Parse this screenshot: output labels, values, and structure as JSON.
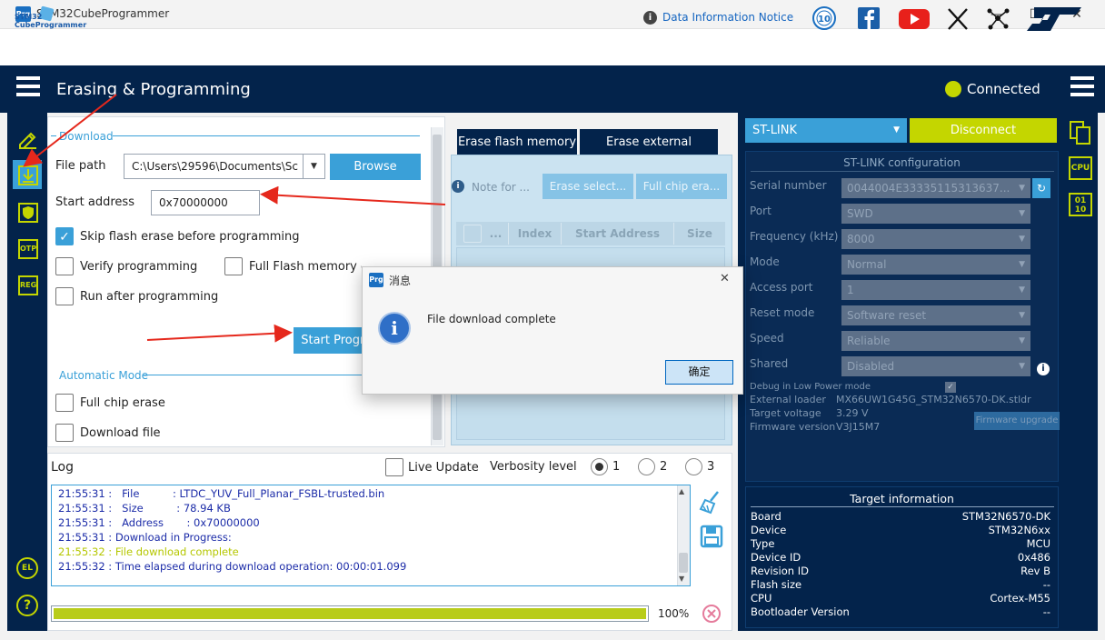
{
  "window": {
    "app_icon": "Prg",
    "title": "STM32CubeProgrammer",
    "minimize": "—",
    "maximize": "☐",
    "close": "✕"
  },
  "header": {
    "logo_line1": "STM32",
    "logo_line2": "CubeProgrammer",
    "notice_icon": "i",
    "notice_link": "Data Information Notice",
    "anniversary_badge": "10",
    "social_icons": [
      "anniversary-icon",
      "facebook-icon",
      "youtube-icon",
      "x-icon",
      "network-icon",
      "st-logo-icon"
    ]
  },
  "ribbon": {
    "page_title": "Erasing & Programming",
    "connection_status": "Connected",
    "status_color": "#c4d600"
  },
  "sidebar": {
    "items": [
      "edit-icon",
      "download-icon",
      "shield-icon",
      "otp-icon",
      "reg-icon"
    ],
    "otp_label": "OTP",
    "reg_label": "REG",
    "bottom_el_icon": "EL",
    "help_icon": "?"
  },
  "download": {
    "section_label": "Download",
    "file_path_label": "File path",
    "file_path_value": "C:\\Users\\29596\\Documents\\Sc",
    "browse_label": "Browse",
    "start_address_label": "Start address",
    "start_address_value": "0x70000000",
    "skip_flash_erase_label": "Skip flash erase before programming",
    "skip_flash_erase_checked": true,
    "verify_label": "Verify programming",
    "full_checksum_label": "Full Flash memory checksum",
    "run_after_label": "Run after programming",
    "start_button_label": "Start Programming"
  },
  "automatic_mode": {
    "section_label": "Automatic Mode",
    "full_chip_erase_label": "Full chip erase",
    "download_file_label": "Download file"
  },
  "erase": {
    "tab_flash": "Erase flash memory",
    "tab_external": "Erase external memory",
    "note_label": "Note for ...",
    "erase_selected_label": "Erase select...",
    "full_chip_label": "Full chip era...",
    "columns": [
      "...",
      "Index",
      "Start Address",
      "Size"
    ]
  },
  "log": {
    "title": "Log",
    "live_update_label": "Live Update",
    "verbosity_label": "Verbosity level",
    "levels": [
      "1",
      "2",
      "3"
    ],
    "selected_level": "1",
    "lines": [
      "21:55:31 :   File          : LTDC_YUV_Full_Planar_FSBL-trusted.bin",
      "21:55:31 :   Size          : 78.94 KB",
      "21:55:31 :   Address       : 0x70000000",
      "21:55:31 : Download in Progress:",
      "21:55:32 : File download complete",
      "21:55:32 : Time elapsed during download operation: 00:00:01.099"
    ],
    "progress_fraction": 1.0,
    "progress_text": "100%"
  },
  "stlink": {
    "dropdown_label": "ST-LINK",
    "disconnect_label": "Disconnect",
    "config_title": "ST-LINK configuration",
    "fields": [
      {
        "label": "Serial number",
        "value": "0044004E33335115313637..."
      },
      {
        "label": "Port",
        "value": "SWD"
      },
      {
        "label": "Frequency (kHz)",
        "value": "8000"
      },
      {
        "label": "Mode",
        "value": "Normal"
      },
      {
        "label": "Access port",
        "value": "1"
      },
      {
        "label": "Reset mode",
        "value": "Software reset"
      },
      {
        "label": "Speed",
        "value": "Reliable"
      },
      {
        "label": "Shared",
        "value": "Disabled"
      }
    ],
    "debug_low_power_label": "Debug in Low Power mode",
    "external_loader_label": "External loader",
    "external_loader_value": "MX66UW1G45G_STM32N6570-DK.stldr",
    "target_voltage_label": "Target voltage",
    "target_voltage_value": "3.29 V",
    "firmware_version_label": "Firmware version",
    "firmware_version_value": "V3J15M7",
    "firmware_upgrade_label": "Firmware upgrade"
  },
  "target": {
    "title": "Target information",
    "rows": [
      {
        "label": "Board",
        "value": "STM32N6570-DK"
      },
      {
        "label": "Device",
        "value": "STM32N6xx"
      },
      {
        "label": "Type",
        "value": "MCU"
      },
      {
        "label": "Device ID",
        "value": "0x486"
      },
      {
        "label": "Revision ID",
        "value": "Rev B"
      },
      {
        "label": "Flash size",
        "value": "--"
      },
      {
        "label": "CPU",
        "value": "Cortex-M55"
      },
      {
        "label": "Bootloader Version",
        "value": "--"
      }
    ]
  },
  "far_right": {
    "cpu_label": "CPU",
    "binary_label_top": "01",
    "binary_label_bottom": "10"
  },
  "dialog": {
    "icon": "Prg",
    "title": "消息",
    "close": "✕",
    "info_icon": "i",
    "message": "File download complete",
    "ok_label": "确定"
  }
}
